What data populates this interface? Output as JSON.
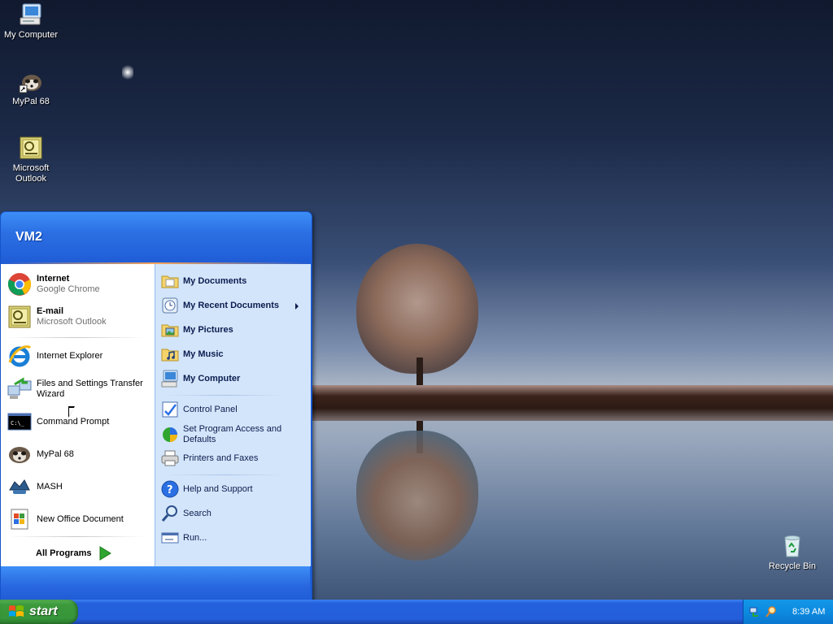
{
  "desktop": {
    "icons": [
      {
        "label": "My Computer"
      },
      {
        "label": "MyPal 68"
      },
      {
        "label": "Microsoft Outlook"
      },
      {
        "label": "Recycle Bin"
      }
    ]
  },
  "start_menu": {
    "user": "VM2",
    "left_items": [
      {
        "title": "Internet",
        "subtitle": "Google Chrome",
        "icon": "chrome-icon"
      },
      {
        "title": "E-mail",
        "subtitle": "Microsoft Outlook",
        "icon": "outlook-icon"
      },
      {
        "title": "Internet Explorer",
        "icon": "ie-icon"
      },
      {
        "title": "Files and Settings Transfer Wizard",
        "icon": "transfer-wizard-icon"
      },
      {
        "title": "Command Prompt",
        "icon": "cmd-icon"
      },
      {
        "title": "MyPal 68",
        "icon": "mypal-icon"
      },
      {
        "title": "MASH",
        "icon": "mash-icon"
      },
      {
        "title": "New Office Document",
        "icon": "office-doc-icon"
      }
    ],
    "all_programs": "All Programs",
    "right_items": [
      {
        "label": "My Documents"
      },
      {
        "label": "My Recent Documents"
      },
      {
        "label": "My Pictures"
      },
      {
        "label": "My Music"
      },
      {
        "label": "My Computer"
      },
      {
        "label": "Control Panel"
      },
      {
        "label": "Set Program Access and Defaults"
      },
      {
        "label": "Printers and Faxes"
      },
      {
        "label": "Help and Support"
      },
      {
        "label": "Search"
      },
      {
        "label": "Run..."
      }
    ]
  },
  "taskbar": {
    "start_label": "start",
    "clock": "8:39 AM"
  }
}
